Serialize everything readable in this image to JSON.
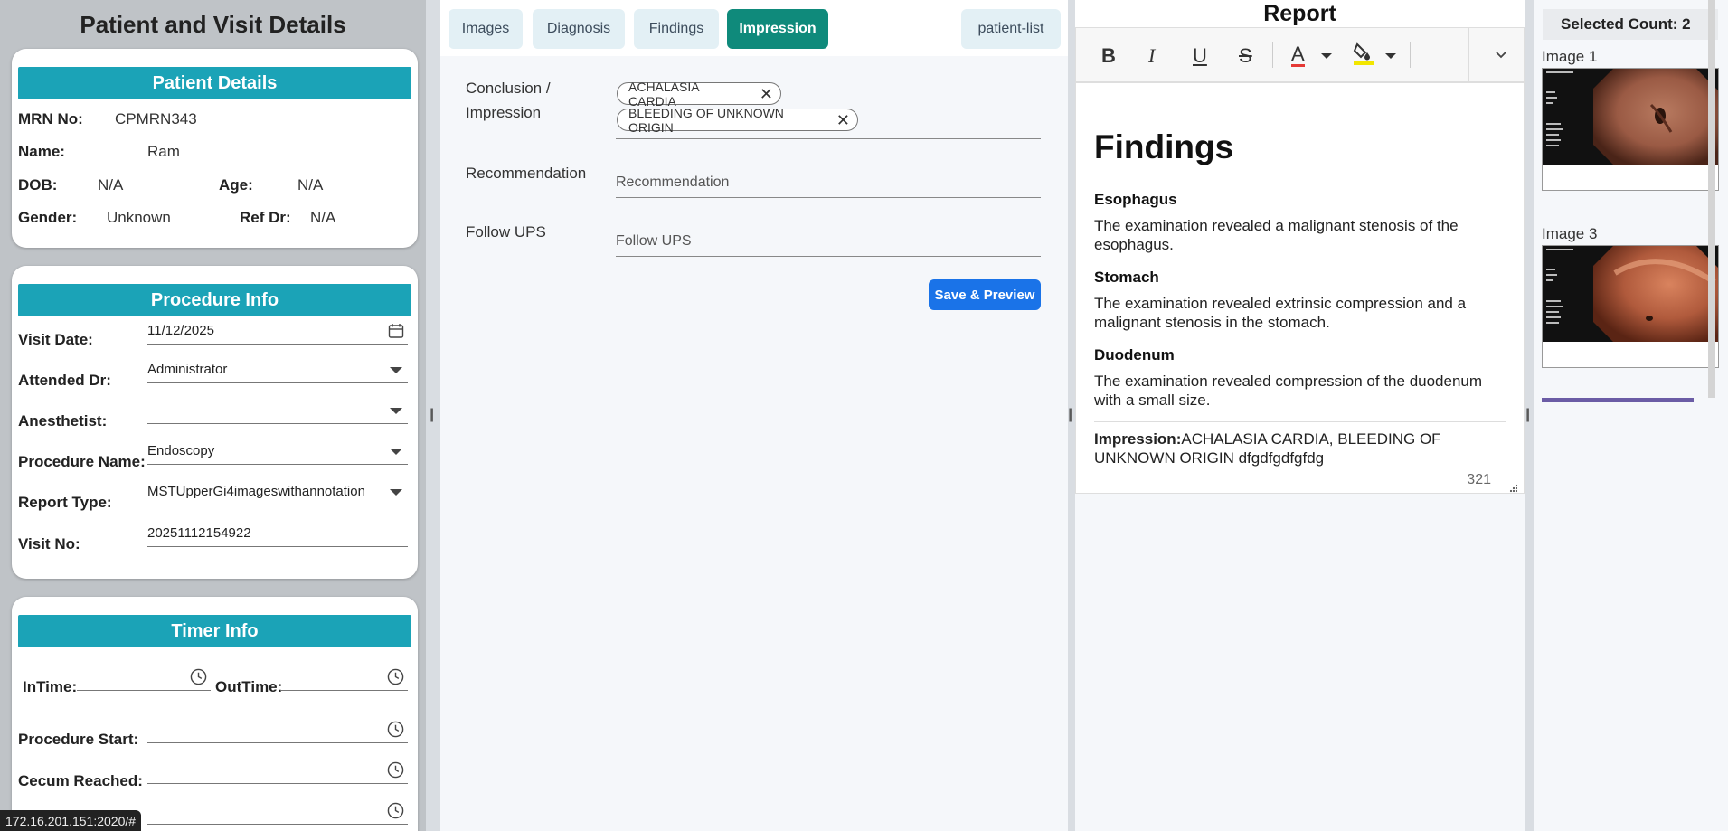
{
  "left": {
    "title": "Patient and Visit Details",
    "patient": {
      "header": "Patient Details",
      "mrn_label": "MRN No:",
      "mrn": "CPMRN343",
      "name_label": "Name:",
      "name": "Ram",
      "dob_label": "DOB:",
      "dob": "N/A",
      "age_label": "Age:",
      "age": "N/A",
      "gender_label": "Gender:",
      "gender": "Unknown",
      "refdr_label": "Ref Dr:",
      "refdr": "N/A"
    },
    "procedure": {
      "header": "Procedure Info",
      "visit_date_label": "Visit Date:",
      "visit_date": "11/12/2025",
      "attended_label": "Attended Dr:",
      "attended": "Administrator",
      "anesthetist_label": "Anesthetist:",
      "anesthetist": "",
      "procname_label": "Procedure Name:",
      "procname": "Endoscopy",
      "reporttype_label": "Report Type:",
      "reporttype": "MSTUpperGi4imageswithannotation",
      "visitno_label": "Visit No:",
      "visitno": "20251112154922"
    },
    "timer": {
      "header": "Timer Info",
      "intime_label": "InTime:",
      "outtime_label": "OutTime:",
      "procstart_label": "Procedure Start:",
      "cecum_label": "Cecum Reached:"
    }
  },
  "tabs": [
    "Images",
    "Diagnosis",
    "Findings",
    "Impression",
    "patient-list"
  ],
  "impression_form": {
    "conclusion_label": "Conclusion /\nImpression",
    "chips": [
      "ACHALASIA CARDIA",
      "BLEEDING OF UNKNOWN ORIGIN"
    ],
    "recommendation_label": "Recommendation",
    "recommendation_placeholder": "Recommendation",
    "follow_label": "Follow UPS",
    "follow_placeholder": "Follow UPS",
    "save_label": "Save & Preview"
  },
  "report": {
    "title": "Report",
    "toolbar": {
      "bold": "B",
      "italic": "I",
      "underline": "U",
      "strike": "S",
      "font_color": "A",
      "font_color_accent": "#e53935",
      "highlight_accent": "#f2e600"
    },
    "heading": "Findings",
    "sections": [
      {
        "title": "Esophagus",
        "text": "The examination revealed a malignant stenosis of the esophagus."
      },
      {
        "title": "Stomach",
        "text": "The examination revealed extrinsic compression and a malignant stenosis in the stomach."
      },
      {
        "title": "Duodenum",
        "text": "The examination revealed compression of the duodenum with a small size."
      }
    ],
    "impression_label": "Impression:",
    "impression_text": "ACHALASIA CARDIA, BLEEDING OF UNKNOWN ORIGIN dfgdfgdfgfdg",
    "word_count": "321"
  },
  "images": {
    "selected_count": "Selected Count: 2",
    "items": [
      {
        "label": "Image 1"
      },
      {
        "label": "Image 3"
      }
    ]
  },
  "status_url": "172.16.201.151:2020/#",
  "colors": {
    "accent_teal": "#1ba3b7",
    "active_tab": "#0f8a7b",
    "save_blue": "#1a73e8"
  }
}
